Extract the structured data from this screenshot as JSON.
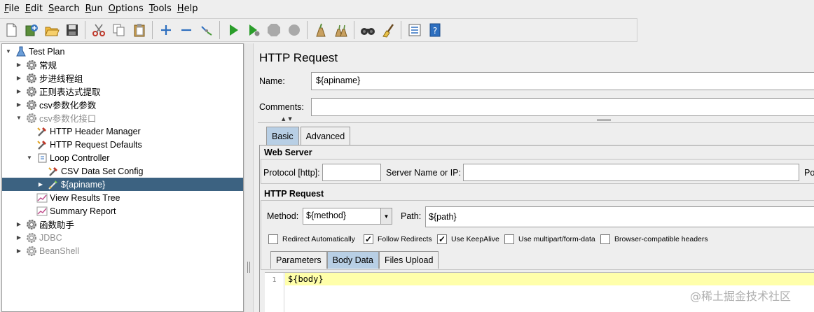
{
  "menu": [
    {
      "mn": "F",
      "rest": "ile"
    },
    {
      "mn": "E",
      "rest": "dit"
    },
    {
      "mn": "S",
      "rest": "earch"
    },
    {
      "mn": "R",
      "rest": "un"
    },
    {
      "mn": "O",
      "rest": "ptions"
    },
    {
      "mn": "T",
      "rest": "ools"
    },
    {
      "mn": "H",
      "rest": "elp"
    }
  ],
  "toolbar": [
    "new-icon",
    "templates-icon",
    "open-icon",
    "save-icon",
    "cut-icon",
    "copy-icon",
    "paste-icon",
    "expand-icon",
    "collapse-icon",
    "toggle-icon",
    "start-icon",
    "start-no-pause-icon",
    "stop-icon",
    "shutdown-icon",
    "clear-icon",
    "clear-all-icon",
    "search-icon",
    "reset-search-icon",
    "function-helper-icon",
    "help-icon"
  ],
  "tree": [
    {
      "label": "Test Plan",
      "icon": "flask-icon",
      "toggle": "open",
      "dim": false
    },
    {
      "label": "常规",
      "icon": "gear-icon",
      "toggle": "closed",
      "dim": false
    },
    {
      "label": "步进线程组",
      "icon": "gear-icon",
      "toggle": "closed",
      "dim": false
    },
    {
      "label": "正则表达式提取",
      "icon": "gear-icon",
      "toggle": "closed",
      "dim": false
    },
    {
      "label": "csv参数化参数",
      "icon": "gear-icon",
      "toggle": "closed",
      "dim": false
    },
    {
      "label": "csv参数化接口",
      "icon": "gear-icon",
      "toggle": "open",
      "dim": true
    },
    {
      "label": "HTTP Header Manager",
      "icon": "config-icon",
      "toggle": "",
      "dim": false
    },
    {
      "label": "HTTP Request Defaults",
      "icon": "config-icon",
      "toggle": "",
      "dim": false
    },
    {
      "label": "Loop Controller",
      "icon": "controller-icon",
      "toggle": "open",
      "dim": false
    },
    {
      "label": "CSV Data Set Config",
      "icon": "config-icon",
      "toggle": "",
      "dim": false
    },
    {
      "label": "${apiname}",
      "icon": "sampler-icon",
      "toggle": "closed",
      "dim": false
    },
    {
      "label": "View Results Tree",
      "icon": "listener-icon",
      "toggle": "",
      "dim": false
    },
    {
      "label": "Summary Report",
      "icon": "listener-icon",
      "toggle": "",
      "dim": false
    },
    {
      "label": "函数助手",
      "icon": "gear-icon",
      "toggle": "closed",
      "dim": false
    },
    {
      "label": "JDBC",
      "icon": "gear-icon",
      "toggle": "closed",
      "dim": true
    },
    {
      "label": "BeanShell",
      "icon": "gear-icon",
      "toggle": "closed",
      "dim": true
    }
  ],
  "panel": {
    "title": "HTTP Request",
    "name_label": "Name:",
    "name_value": "${apiname}",
    "comments_label": "Comments:",
    "comments_value": "",
    "tabs": [
      "Basic",
      "Advanced"
    ],
    "active_tab": "Basic"
  },
  "web_server": {
    "title": "Web Server",
    "protocol_label": "Protocol [http]:",
    "protocol_value": "",
    "server_label": "Server Name or IP:",
    "server_value": "",
    "port_label": "Po"
  },
  "http_request": {
    "title": "HTTP Request",
    "method_label": "Method:",
    "method_value": "${method}",
    "path_label": "Path:",
    "path_value": "${path}",
    "checkboxes": [
      {
        "label": "Redirect Automatically",
        "checked": false
      },
      {
        "label": "Follow Redirects",
        "checked": true
      },
      {
        "label": "Use KeepAlive",
        "checked": true
      },
      {
        "label": "Use multipart/form-data",
        "checked": false
      },
      {
        "label": "Browser-compatible headers",
        "checked": false
      }
    ],
    "subtabs": [
      "Parameters",
      "Body Data",
      "Files Upload"
    ],
    "active_subtab": "Body Data"
  },
  "editor": {
    "line_number": "1",
    "code": "${body}"
  },
  "watermark": "@稀土掘金技术社区",
  "colors": {
    "selection": "#3c6281",
    "active_tab": "#b8cfe5",
    "code_highlight": "#ffffaa"
  }
}
